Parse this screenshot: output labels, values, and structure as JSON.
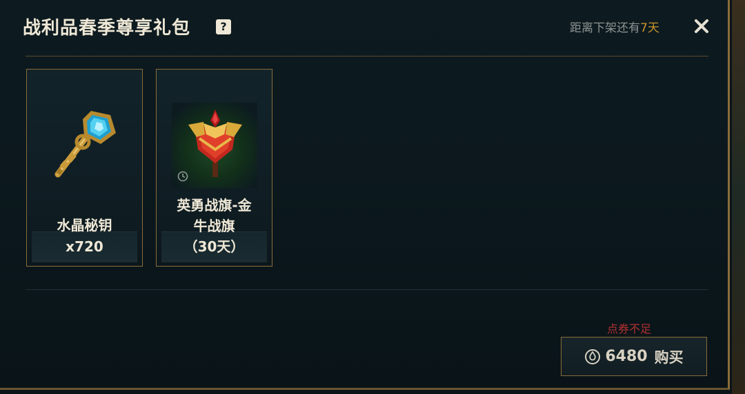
{
  "header": {
    "title": "战利品春季尊享礼包",
    "help_icon": "question-icon",
    "countdown_prefix": "距离下架还有",
    "countdown_days": "7天",
    "close_icon": "close-icon"
  },
  "items": [
    {
      "icon": "crystal-key-icon",
      "line1": "水晶秘钥",
      "line2": "x720"
    },
    {
      "icon": "banner-emblem-icon",
      "line1": "英勇战旗-金",
      "line2": "牛战旗",
      "line3": "（30天）",
      "badge_icon": "clock-icon"
    }
  ],
  "purchase": {
    "warning": "点券不足",
    "currency_icon": "coupon-icon",
    "price": "6480",
    "label": "购买"
  },
  "colors": {
    "gold": "#c9952b",
    "border_gold": "#8a6d3b",
    "warning_red": "#b33030",
    "text": "#efe8d6"
  }
}
